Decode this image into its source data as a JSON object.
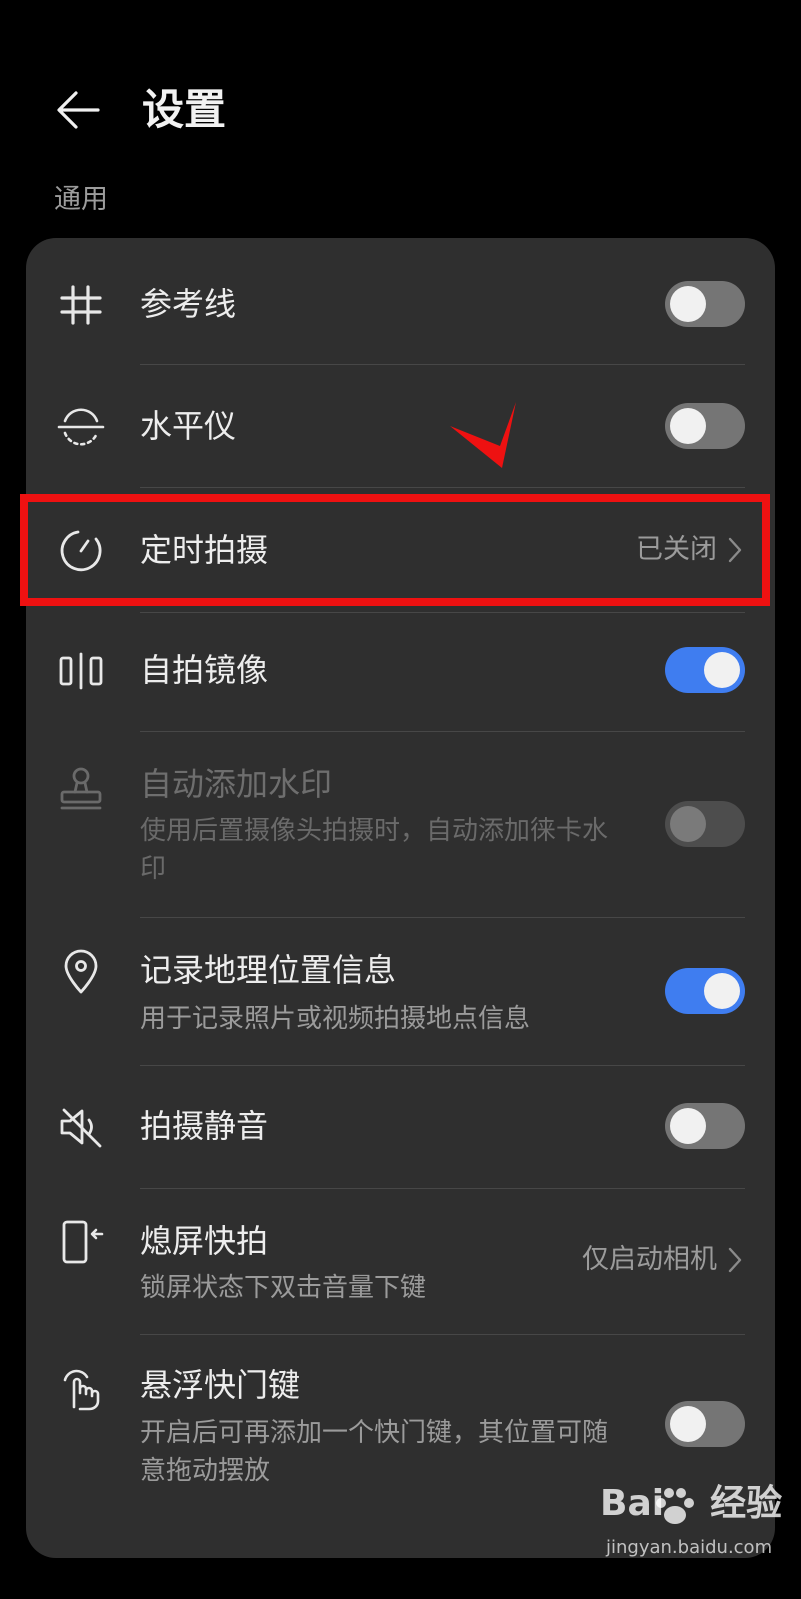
{
  "header": {
    "title": "设置"
  },
  "section": {
    "label": "通用"
  },
  "items": [
    {
      "label": "参考线",
      "icon": "grid-icon",
      "control": "toggle",
      "on": false
    },
    {
      "label": "水平仪",
      "icon": "level-icon",
      "control": "toggle",
      "on": false
    },
    {
      "label": "定时拍摄",
      "icon": "timer-icon",
      "control": "value",
      "value": "已关闭"
    },
    {
      "label": "自拍镜像",
      "icon": "mirror-icon",
      "control": "toggle",
      "on": true
    },
    {
      "label": "自动添加水印",
      "sub": "使用后置摄像头拍摄时，自动添加徕卡水印",
      "icon": "stamp-icon",
      "control": "toggle",
      "on": false,
      "disabled": true
    },
    {
      "label": "记录地理位置信息",
      "sub": "用于记录照片或视频拍摄地点信息",
      "icon": "location-pin-icon",
      "control": "toggle",
      "on": true
    },
    {
      "label": "拍摄静音",
      "icon": "mute-icon",
      "control": "toggle",
      "on": false
    },
    {
      "label": "熄屏快拍",
      "sub": "锁屏状态下双击音量下键",
      "icon": "phone-side-key-icon",
      "control": "value",
      "value": "仅启动相机"
    },
    {
      "label": "悬浮快门键",
      "sub": "开启后可再添加一个快门键，其位置可随意拖动摆放",
      "icon": "touch-hand-icon",
      "control": "toggle",
      "on": false
    }
  ],
  "watermark": {
    "brand_a": "Bai",
    "brand_b": "经验",
    "url": "jingyan.baidu.com"
  },
  "colors": {
    "background": "#000000",
    "card": "#2f2f2f",
    "toggle_on": "#3f7df0",
    "toggle_off": "#757575",
    "annotation": "#ee1111"
  }
}
